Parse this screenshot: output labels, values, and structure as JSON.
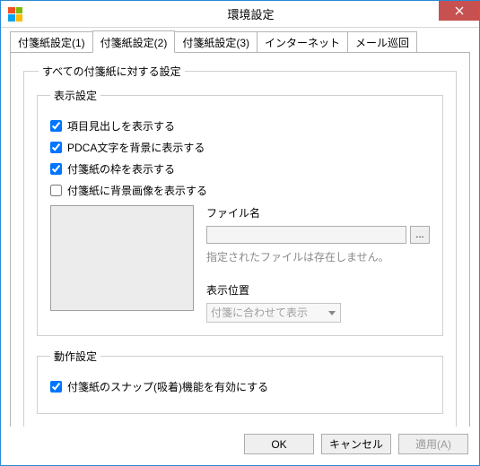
{
  "window": {
    "title": "環境設定"
  },
  "tabs": [
    {
      "label": "付箋紙設定(1)"
    },
    {
      "label": "付箋紙設定(2)"
    },
    {
      "label": "付箋紙設定(3)"
    },
    {
      "label": "インターネット"
    },
    {
      "label": "メール巡回"
    }
  ],
  "active_tab_index": 1,
  "outer_group_title": "すべての付箋紙に対する設定",
  "display_group": {
    "title": "表示設定",
    "check_show_heading": {
      "label": "項目見出しを表示する",
      "checked": true
    },
    "check_pdca_bg": {
      "label": "PDCA文字を背景に表示する",
      "checked": true
    },
    "check_show_frame": {
      "label": "付箋紙の枠を表示する",
      "checked": true
    },
    "check_bg_image": {
      "label": "付箋紙に背景画像を表示する",
      "checked": false
    },
    "file_label": "ファイル名",
    "file_value": "",
    "browse_label": "...",
    "file_hint": "指定されたファイルは存在しません。",
    "position_label": "表示位置",
    "position_value": "付箋に合わせて表示"
  },
  "behavior_group": {
    "title": "動作設定",
    "check_snap": {
      "label": "付箋紙のスナップ(吸着)機能を有効にする",
      "checked": true
    }
  },
  "buttons": {
    "ok": "OK",
    "cancel": "キャンセル",
    "apply": "適用(A)"
  }
}
